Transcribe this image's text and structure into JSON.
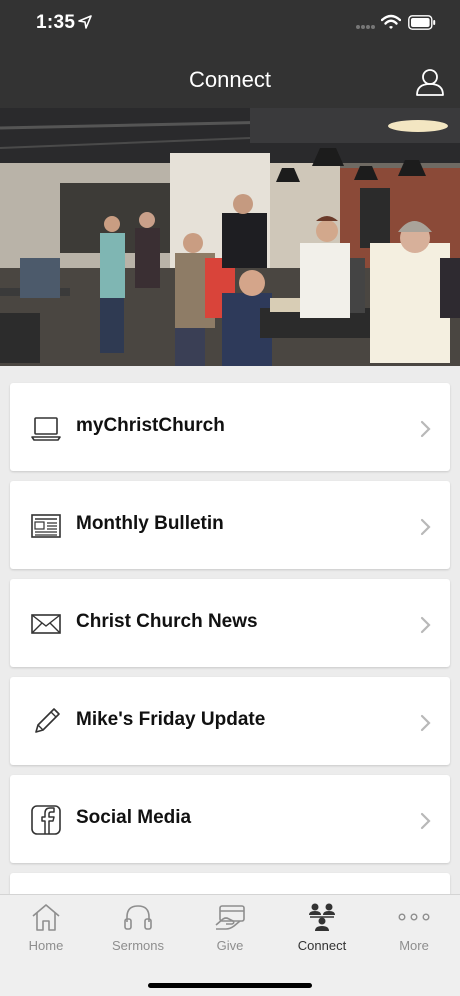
{
  "status": {
    "time": "1:35"
  },
  "nav": {
    "title": "Connect"
  },
  "hero": {
    "alt": "church fellowship hall photo"
  },
  "menu": [
    {
      "label": "myChristChurch",
      "icon": "laptop-icon"
    },
    {
      "label": "Monthly Bulletin",
      "icon": "newspaper-icon"
    },
    {
      "label": "Christ Church News",
      "icon": "envelope-icon"
    },
    {
      "label": "Mike's Friday Update",
      "icon": "pencil-icon"
    },
    {
      "label": "Social Media",
      "icon": "facebook-icon"
    }
  ],
  "tabs": [
    {
      "label": "Home",
      "icon": "home-icon",
      "active": false
    },
    {
      "label": "Sermons",
      "icon": "headphones-icon",
      "active": false
    },
    {
      "label": "Give",
      "icon": "give-card-icon",
      "active": false
    },
    {
      "label": "Connect",
      "icon": "people-icon",
      "active": true
    },
    {
      "label": "More",
      "icon": "more-dots-icon",
      "active": false
    }
  ],
  "colors": {
    "header": "#333333",
    "background": "#ececec",
    "tab_inactive": "#8e8e8e",
    "tab_active": "#333333"
  }
}
